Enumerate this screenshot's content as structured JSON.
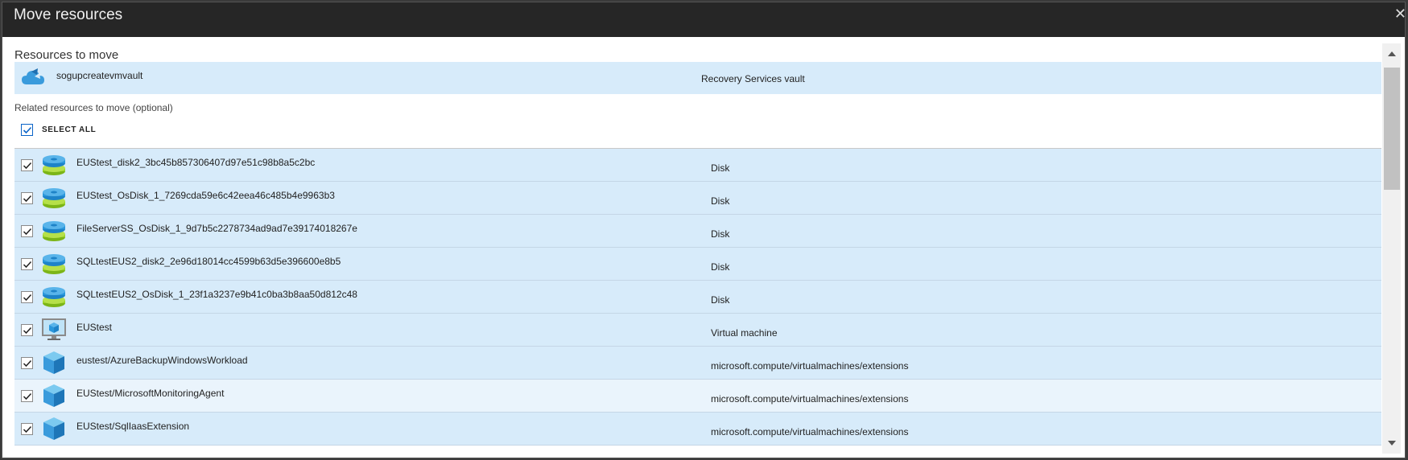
{
  "dialog": {
    "title": "Move resources",
    "close_icon": "close-icon"
  },
  "resources_to_move": {
    "label": "Resources to move",
    "vault": {
      "name": "sogupcreatevmvault",
      "type": "Recovery Services vault",
      "icon": "recovery-vault-icon"
    }
  },
  "related": {
    "label": "Related resources to move (optional)",
    "select_all_label": "SELECT ALL",
    "select_all_checked": true,
    "items": [
      {
        "name": "EUStest_disk2_3bc45b857306407d97e51c98b8a5c2bc",
        "type": "Disk",
        "icon": "disk-icon",
        "checked": true
      },
      {
        "name": "EUStest_OsDisk_1_7269cda59e6c42eea46c485b4e9963b3",
        "type": "Disk",
        "icon": "disk-icon",
        "checked": true
      },
      {
        "name": "FileServerSS_OsDisk_1_9d7b5c2278734ad9ad7e39174018267e",
        "type": "Disk",
        "icon": "disk-icon",
        "checked": true
      },
      {
        "name": "SQLtestEUS2_disk2_2e96d18014cc4599b63d5e396600e8b5",
        "type": "Disk",
        "icon": "disk-icon",
        "checked": true
      },
      {
        "name": "SQLtestEUS2_OsDisk_1_23f1a3237e9b41c0ba3b8aa50d812c48",
        "type": "Disk",
        "icon": "disk-icon",
        "checked": true
      },
      {
        "name": "EUStest",
        "type": "Virtual machine",
        "icon": "virtual-machine-icon",
        "checked": true
      },
      {
        "name": "eustest/AzureBackupWindowsWorkload",
        "type": "microsoft.compute/virtualmachines/extensions",
        "icon": "extension-cube-icon",
        "checked": true
      },
      {
        "name": "EUStest/MicrosoftMonitoringAgent",
        "type": "microsoft.compute/virtualmachines/extensions",
        "icon": "extension-cube-icon",
        "checked": true
      },
      {
        "name": "EUStest/SqlIaasExtension",
        "type": "microsoft.compute/virtualmachines/extensions",
        "icon": "extension-cube-icon",
        "checked": true
      }
    ]
  }
}
